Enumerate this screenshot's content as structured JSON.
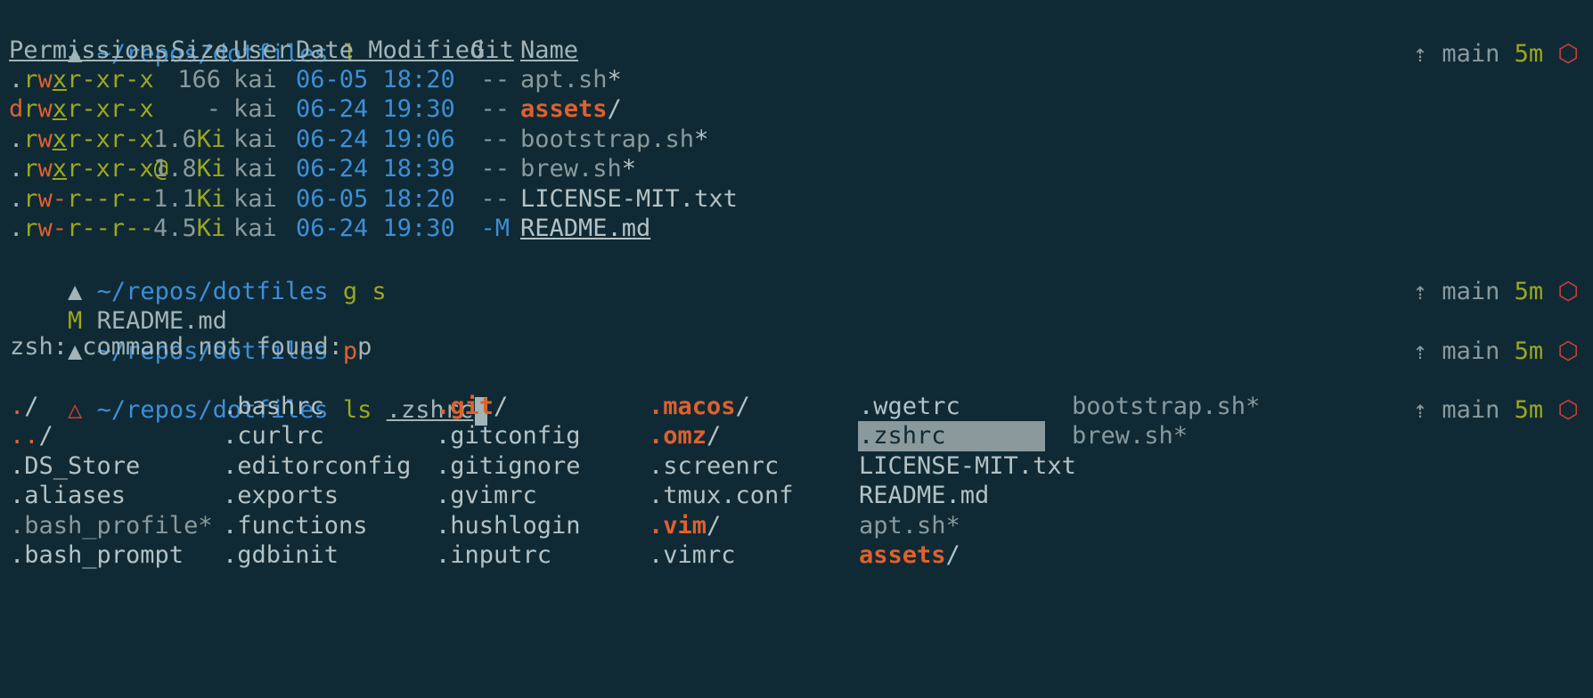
{
  "prompt": {
    "path": "~/repos/dotfiles",
    "triangle": "▲",
    "triangle_warn": "△"
  },
  "status": {
    "arrow": "⇡",
    "branch": "main",
    "time": "5m",
    "hex": "⬡"
  },
  "commands": {
    "c1": "l",
    "c2": "g s",
    "c3": "p",
    "c4_cmd": "ls",
    "c4_arg": ".zshrc"
  },
  "ls_headers": [
    "Permissions",
    "Size",
    "User",
    "Date Modified",
    "Git",
    "Name"
  ],
  "ls_rows": [
    {
      "perm_d": ".",
      "perm_r": "r",
      "perm_w": "w",
      "perm_x": "x",
      "perm_rest": "r-xr-x",
      "size_num": "166",
      "size_unit": "",
      "user": "kai",
      "date": "06-05 18:20",
      "git": "--",
      "name": "apt.sh",
      "suffix": "*"
    },
    {
      "perm_d": "d",
      "perm_r": "r",
      "perm_w": "w",
      "perm_x": "x",
      "perm_rest": "r-xr-x",
      "size_num": "-",
      "size_unit": "",
      "user": "kai",
      "date": "06-24 19:30",
      "git": "--",
      "name": "assets",
      "suffix": "/"
    },
    {
      "perm_d": ".",
      "perm_r": "r",
      "perm_w": "w",
      "perm_x": "x",
      "perm_rest": "r-xr-x",
      "size_num": "1.6",
      "size_unit": "Ki",
      "user": "kai",
      "date": "06-24 19:06",
      "git": "--",
      "name": "bootstrap.sh",
      "suffix": "*"
    },
    {
      "perm_d": ".",
      "perm_r": "r",
      "perm_w": "w",
      "perm_x": "x",
      "perm_rest": "r-xr-x@",
      "size_num": "1.8",
      "size_unit": "Ki",
      "user": "kai",
      "date": "06-24 18:39",
      "git": "--",
      "name": "brew.sh",
      "suffix": "*"
    },
    {
      "perm_d": ".",
      "perm_r": "r",
      "perm_w": "w",
      "perm_x": "-",
      "perm_rest": "r--r--",
      "size_num": "1.1",
      "size_unit": "Ki",
      "user": "kai",
      "date": "06-05 18:20",
      "git": "--",
      "name": "LICENSE-MIT.txt",
      "suffix": ""
    },
    {
      "perm_d": ".",
      "perm_r": "r",
      "perm_w": "w",
      "perm_x": "-",
      "perm_rest": "r--r--",
      "size_num": "4.5",
      "size_unit": "Ki",
      "user": "kai",
      "date": "06-24 19:30",
      "git": "-M",
      "name": "README.md",
      "suffix": ""
    }
  ],
  "git_status": {
    "flag": "M",
    "file": "README.md"
  },
  "error": "zsh: command not found: p",
  "completion": [
    [
      ".",
      "..",
      ".DS_Store",
      ".aliases",
      ".bash_profile*",
      ".bash_prompt"
    ],
    [
      ".bashrc",
      ".curlrc",
      ".editorconfig",
      ".exports",
      ".functions",
      ".gdbinit"
    ],
    [
      ".git",
      ".gitconfig",
      ".gitignore",
      ".gvimrc",
      ".hushlogin",
      ".inputrc"
    ],
    [
      ".macos",
      ".omz",
      ".screenrc",
      ".tmux.conf",
      ".vim",
      ".vimrc"
    ],
    [
      ".wgetrc",
      ".zshrc",
      "LICENSE-MIT.txt",
      "README.md",
      "apt.sh*",
      "assets"
    ],
    [
      "bootstrap.sh*",
      "brew.sh*"
    ]
  ],
  "colors": {
    "bg": "#0f2a35",
    "blue": "#3f8ed6",
    "orange": "#e0602d",
    "olive": "#9ca71d",
    "highlight": "#8a9a9c"
  }
}
